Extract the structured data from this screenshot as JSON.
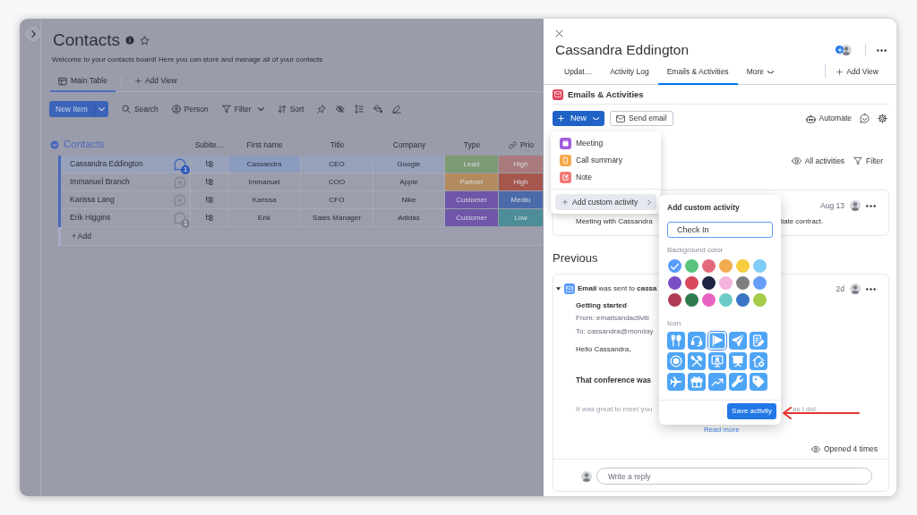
{
  "board": {
    "title": "Contacts",
    "description": "Welcome to your contacts board! Here you can store and manage all of your contacts",
    "views": [
      {
        "label": "Main Table",
        "kind": "table",
        "selected": true
      },
      {
        "label": "Add View",
        "kind": "add",
        "selected": false
      }
    ],
    "toolbar": {
      "new_item": "New Item",
      "tools": [
        {
          "label": "Search",
          "kind": "search",
          "dropdown": false
        },
        {
          "label": "Person",
          "kind": "person",
          "dropdown": false
        },
        {
          "label": "Filter",
          "kind": "filter",
          "dropdown": true
        },
        {
          "label": "Sort",
          "kind": "sort",
          "dropdown": false
        }
      ],
      "icon_tools": [
        {
          "kind": "pin"
        },
        {
          "kind": "hide"
        },
        {
          "kind": "row-height"
        },
        {
          "kind": "paint"
        },
        {
          "kind": "pen"
        }
      ]
    },
    "group": {
      "title": "Contacts",
      "expanded": true
    },
    "columns": [
      "Subite…",
      "First name",
      "Title",
      "Company",
      "Type",
      "Prio"
    ],
    "rows": [
      {
        "name": "Cassandra Eddington",
        "selected": true,
        "updates": "1",
        "unread": true,
        "first_name": "Cassandra",
        "title": "CEO",
        "company": "Google",
        "type": {
          "label": "Lead",
          "color": "#7d9a74"
        },
        "priority": {
          "label": "High",
          "color": "#a8797d"
        }
      },
      {
        "name": "Immanuel Branch",
        "selected": false,
        "first_name": "Immanuel",
        "title": "COO",
        "company": "Apple",
        "type": {
          "label": "Partner",
          "color": "#b38b5e"
        },
        "priority": {
          "label": "High",
          "color": "#a5574d"
        }
      },
      {
        "name": "Karissa Lang",
        "selected": false,
        "first_name": "Karissa",
        "title": "CFO",
        "company": "Nike",
        "type": {
          "label": "Customer",
          "color": "#6f56a8"
        },
        "priority": {
          "label": "Mediu",
          "color": "#4b6aaa"
        }
      },
      {
        "name": "Erik Higgins",
        "selected": false,
        "updates": "1",
        "unread": false,
        "first_name": "Erik",
        "title": "Sales Manager",
        "company": "Adidas",
        "type": {
          "label": "Customer",
          "color": "#6f56a8"
        },
        "priority": {
          "label": "Low",
          "color": "#4d8d97"
        }
      }
    ],
    "add_row": "+ Add"
  },
  "panel": {
    "title": "Cassandra Eddington",
    "tabs": [
      {
        "label": "Updat…",
        "selected": false,
        "dropdown": false
      },
      {
        "label": "Activity Log",
        "selected": false,
        "dropdown": false
      },
      {
        "label": "Emails & Activities",
        "selected": true,
        "dropdown": false
      },
      {
        "label": "More",
        "selected": false,
        "dropdown": true
      }
    ],
    "add_view": "Add View",
    "section_title": "Emails & Activities",
    "new_button": "New",
    "send_email": "Send email",
    "automate": "Automate",
    "new_menu": {
      "items": [
        {
          "label": "Meeting",
          "kind": "meeting",
          "color": "#a25ddc"
        },
        {
          "label": "Call summary",
          "kind": "call",
          "color": "#f5a94b"
        },
        {
          "label": "Note",
          "kind": "note",
          "color": "#f27873"
        }
      ],
      "custom_item": {
        "label": "Add custom activity",
        "selected": true
      }
    },
    "view_filter": "All activities",
    "filter": "Filter",
    "upcoming": {
      "date": "Aug 13",
      "text_start": "Meeting with Cassandra",
      "text_end": "tiate contract."
    },
    "previous_title": "Previous",
    "email": {
      "expanded": true,
      "summary": "**Email** was sent to **cassa**",
      "age": "2d",
      "subject": "Getting started",
      "from": "From: emailsandactiviti",
      "to": "To: cassandra@monday",
      "greeting": "Hello Cassandra,",
      "headline": "That conference was",
      "preview_start": "It was great to meet you",
      "preview_end": "as I did.",
      "read_more": "Read more",
      "opened": "Opened 4 times"
    },
    "reply": {
      "placeholder": "Write a reply"
    }
  },
  "custom_activity": {
    "title": "Add custom activity",
    "name": "Check In",
    "color_label": "Background color",
    "colors": [
      {
        "color": "#579bfc",
        "selected": true
      },
      {
        "color": "#5ac47d",
        "selected": false
      },
      {
        "color": "#e5697d",
        "selected": false
      },
      {
        "color": "#f2ab51",
        "selected": false
      },
      {
        "color": "#f8cd3f",
        "selected": false
      },
      {
        "color": "#7fcdf9",
        "selected": false
      },
      {
        "color": "#7a4fc6",
        "selected": false
      },
      {
        "color": "#d7485c",
        "selected": false
      },
      {
        "color": "#1f2240",
        "selected": false
      },
      {
        "color": "#f3b3da",
        "selected": false
      },
      {
        "color": "#7e7e80",
        "selected": false
      },
      {
        "color": "#679ef5",
        "selected": false
      },
      {
        "color": "#b03a55",
        "selected": false
      },
      {
        "color": "#2f7b4f",
        "selected": false
      },
      {
        "color": "#ea62c1",
        "selected": false
      },
      {
        "color": "#6ccbc8",
        "selected": false
      },
      {
        "color": "#3a73c4",
        "selected": false
      },
      {
        "color": "#a6cc48",
        "selected": false
      }
    ],
    "icon_label": "Icon",
    "icons": [
      {
        "kind": "utensils",
        "selected": false
      },
      {
        "kind": "headset",
        "selected": false
      },
      {
        "kind": "flag",
        "selected": true
      },
      {
        "kind": "send",
        "selected": false
      },
      {
        "kind": "note-edit",
        "selected": false
      },
      {
        "kind": "record",
        "selected": false
      },
      {
        "kind": "tools",
        "selected": false
      },
      {
        "kind": "monitor",
        "selected": false
      },
      {
        "kind": "presentation",
        "selected": false
      },
      {
        "kind": "house",
        "selected": false
      },
      {
        "kind": "airplane",
        "selected": false
      },
      {
        "kind": "gift",
        "selected": false
      },
      {
        "kind": "trend",
        "selected": false
      },
      {
        "kind": "wrench",
        "selected": false
      },
      {
        "kind": "tag",
        "selected": false
      }
    ],
    "save": "Save activity"
  }
}
